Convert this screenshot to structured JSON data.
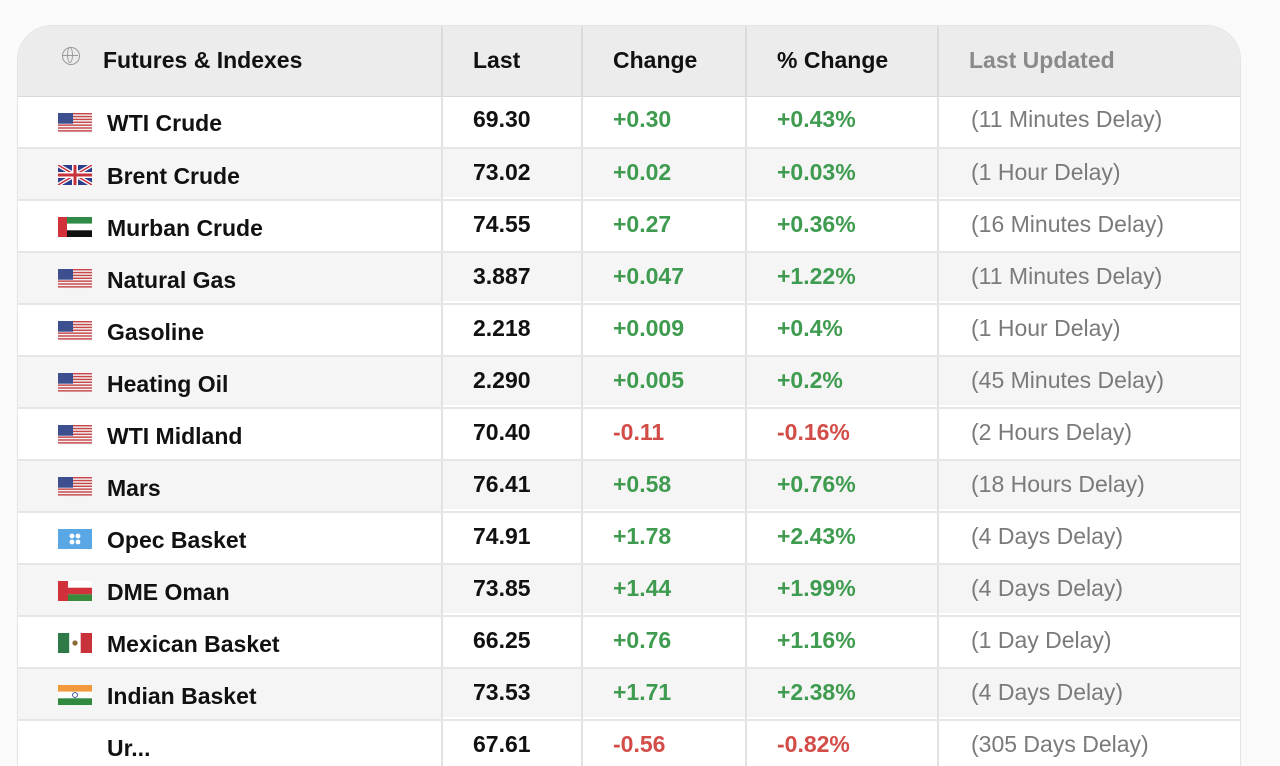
{
  "header": {
    "col_name": "Futures & Indexes",
    "col_last": "Last",
    "col_change": "Change",
    "col_pct_change": "% Change",
    "col_updated": "Last Updated",
    "globe_icon": "globe-icon"
  },
  "colors": {
    "positive": "#3f9b4f",
    "negative": "#d24d48",
    "muted": "#7a7a7a"
  },
  "rows": [
    {
      "flag": "us",
      "name": "WTI Crude",
      "last": "69.30",
      "change": "+0.30",
      "pct": "+0.43%",
      "updated": "(11 Minutes Delay)",
      "dir": "pos"
    },
    {
      "flag": "uk",
      "name": "Brent Crude",
      "last": "73.02",
      "change": "+0.02",
      "pct": "+0.03%",
      "updated": "(1 Hour Delay)",
      "dir": "pos"
    },
    {
      "flag": "uae",
      "name": "Murban Crude",
      "last": "74.55",
      "change": "+0.27",
      "pct": "+0.36%",
      "updated": "(16 Minutes Delay)",
      "dir": "pos"
    },
    {
      "flag": "us",
      "name": "Natural Gas",
      "last": "3.887",
      "change": "+0.047",
      "pct": "+1.22%",
      "updated": "(11 Minutes Delay)",
      "dir": "pos"
    },
    {
      "flag": "us",
      "name": "Gasoline",
      "last": "2.218",
      "change": "+0.009",
      "pct": "+0.4%",
      "updated": "(1 Hour Delay)",
      "dir": "pos"
    },
    {
      "flag": "us",
      "name": "Heating Oil",
      "last": "2.290",
      "change": "+0.005",
      "pct": "+0.2%",
      "updated": "(45 Minutes Delay)",
      "dir": "pos"
    },
    {
      "flag": "us",
      "name": "WTI Midland",
      "last": "70.40",
      "change": "-0.11",
      "pct": "-0.16%",
      "updated": "(2 Hours Delay)",
      "dir": "neg"
    },
    {
      "flag": "us",
      "name": "Mars",
      "last": "76.41",
      "change": "+0.58",
      "pct": "+0.76%",
      "updated": "(18 Hours Delay)",
      "dir": "pos"
    },
    {
      "flag": "opec",
      "name": "Opec Basket",
      "last": "74.91",
      "change": "+1.78",
      "pct": "+2.43%",
      "updated": "(4 Days Delay)",
      "dir": "pos"
    },
    {
      "flag": "oman",
      "name": "DME Oman",
      "last": "73.85",
      "change": "+1.44",
      "pct": "+1.99%",
      "updated": "(4 Days Delay)",
      "dir": "pos"
    },
    {
      "flag": "mexico",
      "name": "Mexican Basket",
      "last": "66.25",
      "change": "+0.76",
      "pct": "+1.16%",
      "updated": "(1 Day Delay)",
      "dir": "pos"
    },
    {
      "flag": "india",
      "name": "Indian Basket",
      "last": "73.53",
      "change": "+1.71",
      "pct": "+2.38%",
      "updated": "(4 Days Delay)",
      "dir": "pos"
    },
    {
      "flag": "",
      "name": "Ur...",
      "last": "67.61",
      "change": "-0.56",
      "pct": "-0.82%",
      "updated": "(305 Days Delay)",
      "dir": "neg"
    }
  ]
}
